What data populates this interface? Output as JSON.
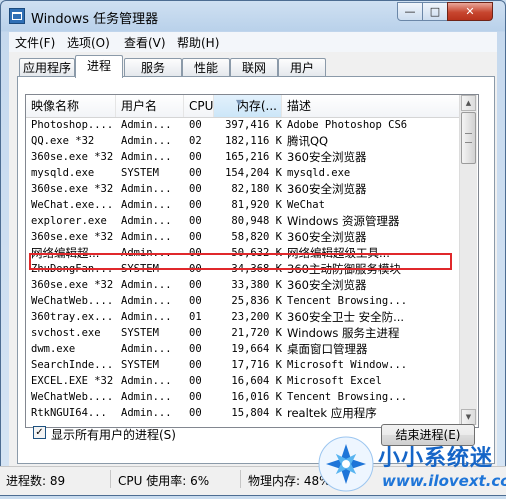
{
  "window": {
    "title": "Windows 任务管理器"
  },
  "controls": {
    "minimize": "—",
    "maximize": "□",
    "close": "✕"
  },
  "menu": [
    "文件(F)",
    "选项(O)",
    "查看(V)",
    "帮助(H)"
  ],
  "tabs": [
    "应用程序",
    "进程",
    "服务",
    "性能",
    "联网",
    "用户"
  ],
  "active_tab": "进程",
  "columns": [
    "映像名称",
    "用户名",
    "CPU",
    "内存(...",
    "描述"
  ],
  "rows": [
    [
      "Photoshop....",
      "Admin...",
      "00",
      "397,416 K",
      "Adobe Photoshop CS6"
    ],
    [
      "QQ.exe *32",
      "Admin...",
      "02",
      "182,116 K",
      "腾讯QQ"
    ],
    [
      "360se.exe *32",
      "Admin...",
      "00",
      "165,216 K",
      "360安全浏览器"
    ],
    [
      "mysqld.exe",
      "SYSTEM",
      "00",
      "154,204 K",
      "mysqld.exe"
    ],
    [
      "360se.exe *32",
      "Admin...",
      "00",
      "82,180 K",
      "360安全浏览器"
    ],
    [
      "WeChat.exe...",
      "Admin...",
      "00",
      "81,920 K",
      "WeChat"
    ],
    [
      "explorer.exe",
      "Admin...",
      "00",
      "80,948 K",
      "Windows 资源管理器"
    ],
    [
      "360se.exe *32",
      "Admin...",
      "00",
      "58,820 K",
      "360安全浏览器"
    ],
    [
      "网络编辑超...",
      "Admin...",
      "00",
      "50,632 K",
      "网络编辑超级工具..."
    ],
    [
      "ZhuDongFan...",
      "SYSTEM",
      "00",
      "34,368 K",
      "360主动防御服务模块"
    ],
    [
      "360se.exe *32",
      "Admin...",
      "00",
      "33,380 K",
      "360安全浏览器"
    ],
    [
      "WeChatWeb....",
      "Admin...",
      "00",
      "25,836 K",
      "Tencent Browsing..."
    ],
    [
      "360tray.ex...",
      "Admin...",
      "01",
      "23,200 K",
      "360安全卫士 安全防..."
    ],
    [
      "svchost.exe",
      "SYSTEM",
      "00",
      "21,720 K",
      "Windows 服务主进程"
    ],
    [
      "dwm.exe",
      "Admin...",
      "00",
      "19,664 K",
      "桌面窗口管理器"
    ],
    [
      "SearchInde...",
      "SYSTEM",
      "00",
      "17,716 K",
      "Microsoft Window..."
    ],
    [
      "EXCEL.EXE *32",
      "Admin...",
      "00",
      "16,604 K",
      "Microsoft Excel"
    ],
    [
      "WeChatWeb....",
      "Admin...",
      "00",
      "16,016 K",
      "Tencent Browsing..."
    ],
    [
      "RtkNGUI64...",
      "Admin...",
      "00",
      "15,804 K",
      "realtek 应用程序"
    ]
  ],
  "highlighted_row": "explorer.exe",
  "show_all_users": {
    "checked": true,
    "label": "显示所有用户的进程(S)"
  },
  "end_process_button": "结束进程(E)",
  "status": {
    "processes": "进程数: 89",
    "cpu": "CPU 使用率: 6%",
    "memory": "物理内存: 48%"
  },
  "watermark": {
    "text": "小小系统迷",
    "url": "www.ilovext.com"
  },
  "colors": {
    "highlight_border": "#e0282b",
    "watermark": "#1565c7"
  }
}
